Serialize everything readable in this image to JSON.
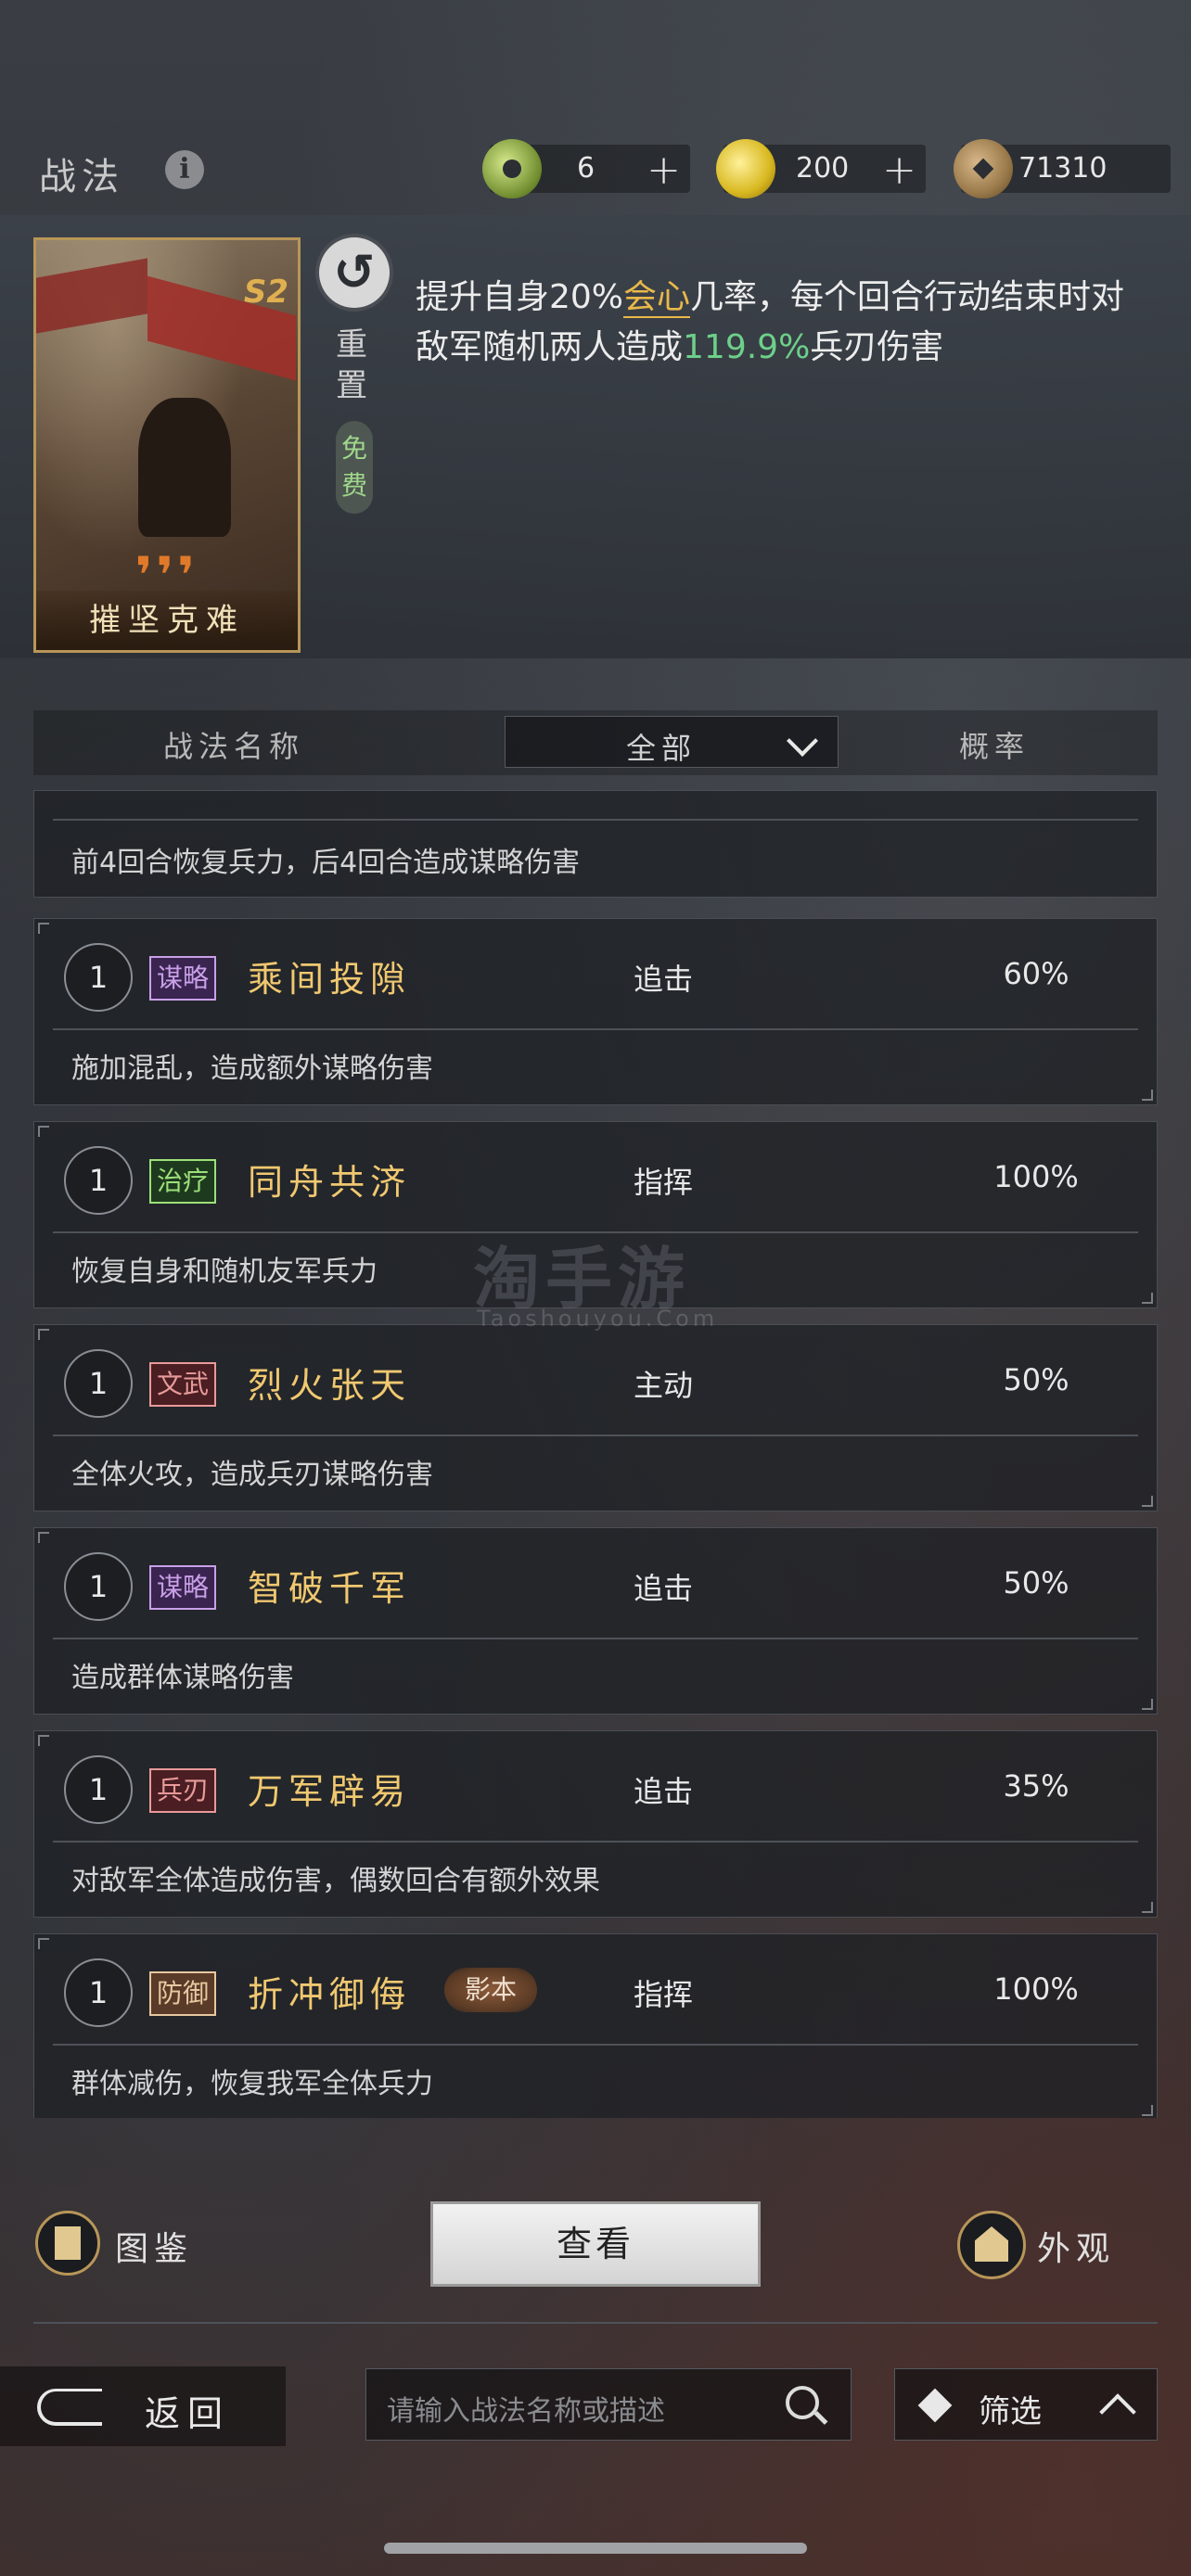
{
  "header": {
    "title": "战法",
    "resources": [
      {
        "icon": "jade-icon",
        "value": "6"
      },
      {
        "icon": "gold-icon",
        "value": "200"
      },
      {
        "icon": "copper-coin-icon",
        "value": "71310"
      }
    ]
  },
  "featured": {
    "card_name": "摧坚克难",
    "season": "S2",
    "reset_label": "重置",
    "free_label": "免费",
    "desc_parts": [
      "提升自身20%",
      "会心",
      "几率，每个回合行动结束时对敌军随机两人造成",
      "119.9%",
      "兵刃伤害"
    ]
  },
  "list_header": {
    "name_col": "战法名称",
    "filter_value": "全部",
    "prob_col": "概率"
  },
  "partial_row": {
    "desc": "前4回合恢复兵力，后4回合造成谋略伤害"
  },
  "rows": [
    {
      "level": "1",
      "tag": "谋略",
      "name": "乘间投隙",
      "type": "追击",
      "prob": "60%",
      "desc": "施加混乱，造成额外谋略伤害"
    },
    {
      "level": "1",
      "tag": "治疗",
      "name": "同舟共济",
      "type": "指挥",
      "prob": "100%",
      "desc": "恢复自身和随机友军兵力"
    },
    {
      "level": "1",
      "tag": "文武",
      "name": "烈火张天",
      "type": "主动",
      "prob": "50%",
      "desc": "全体火攻，造成兵刃谋略伤害"
    },
    {
      "level": "1",
      "tag": "谋略",
      "name": "智破千军",
      "type": "追击",
      "prob": "50%",
      "desc": "造成群体谋略伤害"
    },
    {
      "level": "1",
      "tag": "兵刃",
      "name": "万军辟易",
      "type": "追击",
      "prob": "35%",
      "desc": "对敌军全体造成伤害，偶数回合有额外效果"
    },
    {
      "level": "1",
      "tag": "防御",
      "name": "折冲御侮",
      "badge": "影本",
      "type": "指挥",
      "prob": "100%",
      "desc": "群体减伤，恢复我军全体兵力"
    }
  ],
  "watermark": {
    "main": "淘手游",
    "sub": "Taoshouyou.Com"
  },
  "bottom": {
    "atlas_label": "图鉴",
    "view_label": "查看",
    "appearance_label": "外观",
    "back_label": "返回",
    "search_placeholder": "请输入战法名称或描述",
    "filter_label": "筛选"
  }
}
